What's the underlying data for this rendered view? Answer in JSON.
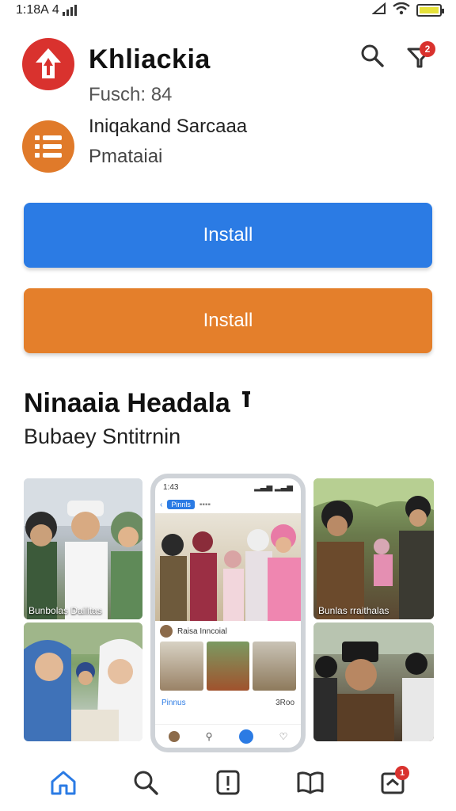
{
  "status_bar": {
    "time": "1:18A",
    "indicator": "4",
    "icons": [
      "signal-bars-icon",
      "wifi-icon",
      "battery-icon"
    ],
    "battery_color": "#e6e23a"
  },
  "header": {
    "app_title": "Khliackia",
    "app_subtitle": "Fusch: 84",
    "logo_icon": "arrow-up-logo-icon",
    "logo_color": "#d9322e",
    "search_icon": "search-icon",
    "filter_icon": "filter-icon",
    "filter_badge": "2"
  },
  "developer": {
    "name": "Iniqakand Sarcaaa",
    "category": "Pmataiai",
    "logo_icon": "list-logo-icon",
    "logo_color": "#e07a2a"
  },
  "buttons": {
    "primary_label": "Install",
    "primary_color": "#2b7be4",
    "secondary_label": "Install",
    "secondary_color": "#e47f2b"
  },
  "section": {
    "title": "Ninaaia Headala",
    "title_icon": "info-icon",
    "subtitle": "Bubaey Sntitrnin"
  },
  "screenshots": {
    "left_top_caption": "Bunbolas Dailitas",
    "right_top_caption": "Bunlas rraithalas",
    "phone": {
      "time": "1:43",
      "nav_chip": "Pinnls",
      "post_text": "Raisa Inncoial",
      "composer_text": "Pinnus",
      "composer_count": "3Roo"
    }
  },
  "bottom_nav": {
    "items": [
      {
        "name": "home",
        "icon": "home-icon",
        "active": true
      },
      {
        "name": "search",
        "icon": "search-icon",
        "active": false
      },
      {
        "name": "updates",
        "icon": "alert-icon",
        "active": false
      },
      {
        "name": "library",
        "icon": "book-icon",
        "active": false
      },
      {
        "name": "inbox",
        "icon": "inbox-icon",
        "active": false,
        "badge": "1"
      }
    ],
    "active_color": "#2b7be4"
  }
}
